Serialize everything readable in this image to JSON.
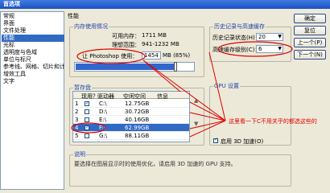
{
  "window": {
    "title": "首选项"
  },
  "sidebar": {
    "items": [
      {
        "label": "常规"
      },
      {
        "label": "界面"
      },
      {
        "label": "文件处理"
      },
      {
        "label": "性能"
      },
      {
        "label": "光标"
      },
      {
        "label": "透明度与色域"
      },
      {
        "label": "单位与标尺"
      },
      {
        "label": "参考线、网格、切片和计数"
      },
      {
        "label": "增效工具"
      },
      {
        "label": "文字"
      }
    ],
    "selected_index": 3
  },
  "panel_title": "性能",
  "memory": {
    "title": "内存使用情况",
    "available_label": "可用内存：",
    "available_value": "1711 MB",
    "ideal_label": "理想范围：",
    "ideal_value": "941-1232 MB",
    "let_use_label": "让 Photoshop 使用：",
    "let_use_value": "1454",
    "let_use_unit": "MB (85%)",
    "usage_fraction": 0.85
  },
  "scratch": {
    "title": "暂存盘",
    "headers": [
      "现用？",
      "驱动器",
      "空闲空间",
      "信息"
    ],
    "rows": [
      {
        "num": "1",
        "checked": true,
        "drive": "C:\\",
        "free": "12.75GB",
        "selected": false
      },
      {
        "num": "2",
        "checked": false,
        "drive": "D:\\",
        "free": "30.72GB",
        "selected": false
      },
      {
        "num": "3",
        "checked": false,
        "drive": "E:\\",
        "free": "40.16GB",
        "selected": false
      },
      {
        "num": "4",
        "checked": true,
        "drive": "F:\\",
        "free": "62.99GB",
        "selected": true
      },
      {
        "num": "5",
        "checked": false,
        "drive": "G:\\",
        "free": "88.11GB",
        "selected": false
      }
    ]
  },
  "history": {
    "title": "历史记录与高速缓存",
    "states_label": "历史记录状态(H)：",
    "states_value": "20",
    "cache_label": "高速缓存级别(C)：",
    "cache_value": "6"
  },
  "gpu": {
    "title": "GPU 设置",
    "opengl_label": "启用 3D 加速(O)",
    "opengl_checked": true
  },
  "annotation": {
    "text": "这里看一下C不用关乎的都选这些的"
  },
  "description": {
    "title": "说明",
    "text": "要选择在图层显示时的使用优化，请启用 3D 加速的 GPU 支持。"
  },
  "buttons": {
    "ok": "确定",
    "reset": "复位",
    "prev": "上一个(P)",
    "next": "下一个(N)"
  },
  "colors": {
    "title_bar": "#1b4fc4",
    "selection": "#316ac5",
    "annotation": "#e00000",
    "group_title": "#1f3fa8"
  }
}
